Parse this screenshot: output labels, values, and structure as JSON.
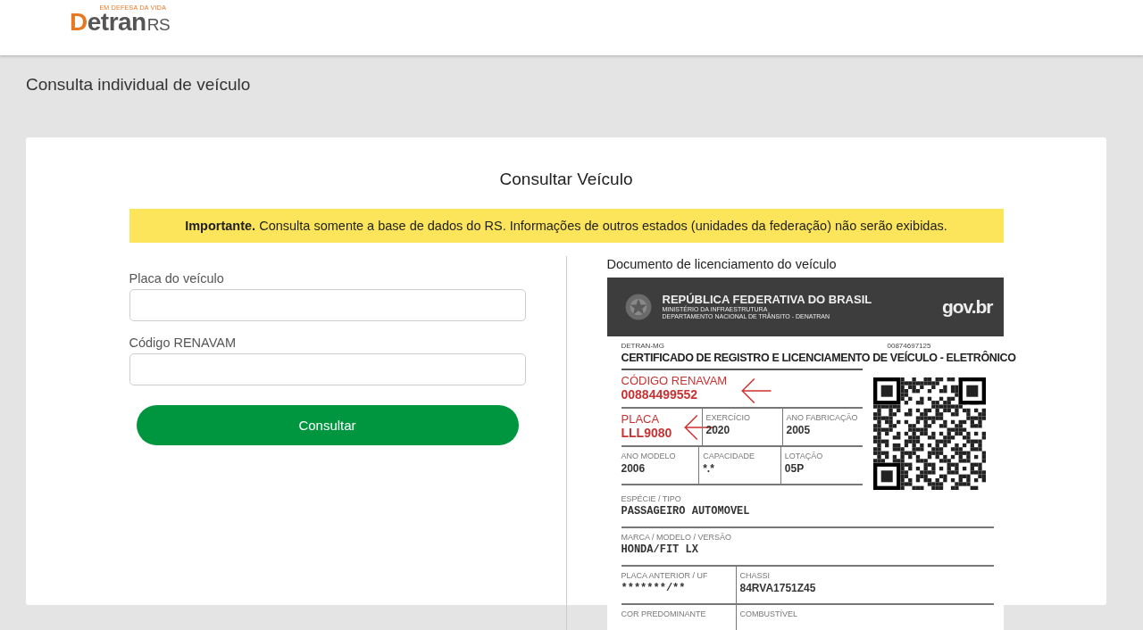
{
  "header": {
    "logo": {
      "tagline": "EM DEFESA DA VIDA",
      "main": "Detran",
      "suffix": "RS"
    }
  },
  "page_title": "Consulta individual de veículo",
  "card": {
    "title": "Consultar Veículo",
    "notice": "**Importante.** Consulta somente a base de dados do RS. Informações de outros estados (unidades da federação) não serão exibidas.",
    "form": {
      "fields": [
        {
          "label": "Placa do veículo"
        },
        {
          "label": "Código RENAVAM"
        }
      ],
      "submit_button": "Consultar"
    },
    "document": {
      "caption": "Documento de licenciamento do veículo",
      "banner": {
        "title": "REPÚBLICA FEDERATIVA DO BRASIL",
        "line_1": "MINISTÉRIO DA INFRAESTRUTURA",
        "line_2": "DEPARTAMENTO NACIONAL DE TRÂNSITO - DENATRAN",
        "brand": "gov.br"
      },
      "issuer": "DETRAN-MG",
      "number": "00874697125",
      "title": "CERTIFICADO DE REGISTRO E LICENCIAMENTO DE VEÍCULO - ELETRÔNICO",
      "top_rows": [
        [
          {
            "label": "CÓDIGO RENAVAM",
            "value": "00884499552",
            "highlighted": true
          }
        ],
        [
          {
            "label": "PLACA",
            "value": "LLL9080",
            "highlighted": true
          },
          {
            "label": "EXERCÍCIO",
            "value": "2020",
            "highlighted": false
          },
          {
            "label": "ANO FABRICAÇÃO",
            "value": "2005",
            "highlighted": false
          }
        ],
        [
          {
            "label": "ANO MODELO",
            "value": "2006",
            "highlighted": false
          },
          {
            "label": "CAPACIDADE",
            "value": "*.*",
            "highlighted": false
          },
          {
            "label": "LOTAÇÃO",
            "value": "05P",
            "highlighted": false
          }
        ]
      ],
      "rows": [
        [
          {
            "label": "ESPÉCIE / TIPO",
            "value": "PASSAGEIRO AUTOMOVEL",
            "mono": true
          }
        ],
        [
          {
            "label": "MARCA / MODELO / VERSÃO",
            "value": "HONDA/FIT LX",
            "mono": true
          }
        ],
        [
          {
            "label": "PLACA ANTERIOR / UF",
            "value": "*******/**",
            "mono": true
          },
          {
            "label": "CHASSI",
            "value": "84RVA1751Z45",
            "mono": false
          }
        ],
        [
          {
            "label": "COR PREDOMINANTE"
          },
          {
            "label": "COMBUSTÍVEL"
          }
        ]
      ]
    }
  }
}
